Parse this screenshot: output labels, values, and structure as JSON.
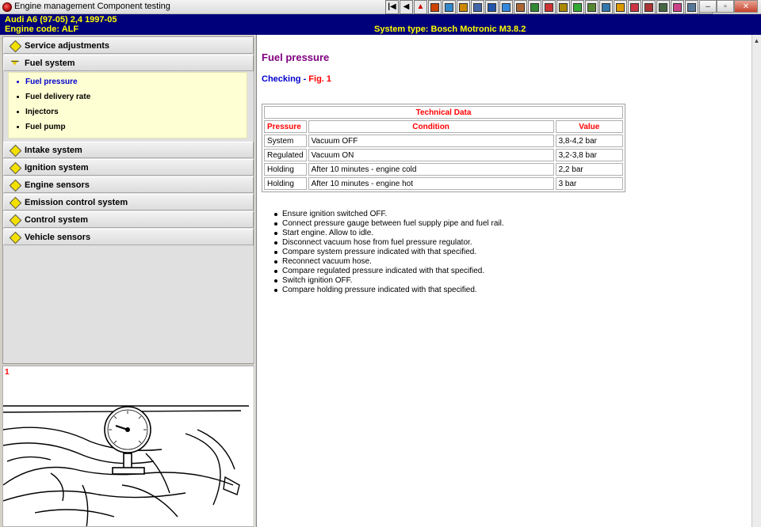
{
  "window": {
    "title": "Engine management Component testing",
    "minimize_label": "–",
    "maximize_label": "▫",
    "close_label": "✕"
  },
  "toolbar": {
    "buttons": [
      {
        "name": "first-icon",
        "glyph": "|◀",
        "color": "#000000"
      },
      {
        "name": "back-icon",
        "glyph": "◀",
        "color": "#000000"
      },
      {
        "name": "warning-icon",
        "glyph": "▲",
        "color": "#cc0000"
      },
      {
        "name": "tool-1-icon",
        "glyph": "",
        "color": "#cc4400"
      },
      {
        "name": "tool-2-icon",
        "glyph": "",
        "color": "#3388cc"
      },
      {
        "name": "tool-3-icon",
        "glyph": "",
        "color": "#cc8800"
      },
      {
        "name": "tool-4-icon",
        "glyph": "",
        "color": "#4466aa"
      },
      {
        "name": "tool-5-icon",
        "glyph": "",
        "color": "#2255aa"
      },
      {
        "name": "tool-6-icon",
        "glyph": "",
        "color": "#3388dd"
      },
      {
        "name": "tool-7-icon",
        "glyph": "",
        "color": "#aa6633"
      },
      {
        "name": "tool-8-icon",
        "glyph": "",
        "color": "#338833"
      },
      {
        "name": "tool-9-icon",
        "glyph": "",
        "color": "#cc3333"
      },
      {
        "name": "tool-10-icon",
        "glyph": "",
        "color": "#aa8800"
      },
      {
        "name": "tool-11-icon",
        "glyph": "",
        "color": "#33aa33"
      },
      {
        "name": "tool-12-icon",
        "glyph": "",
        "color": "#558833"
      },
      {
        "name": "tool-13-icon",
        "glyph": "",
        "color": "#3377aa"
      },
      {
        "name": "tool-14-icon",
        "glyph": "",
        "color": "#dd9900"
      },
      {
        "name": "tool-15-icon",
        "glyph": "",
        "color": "#cc3344"
      },
      {
        "name": "tool-16-icon",
        "glyph": "",
        "color": "#aa3333"
      },
      {
        "name": "tool-17-icon",
        "glyph": "",
        "color": "#446644"
      },
      {
        "name": "tool-18-icon",
        "glyph": "",
        "color": "#cc4488"
      },
      {
        "name": "tool-19-icon",
        "glyph": "",
        "color": "#557799"
      },
      {
        "name": "tool-20-icon",
        "glyph": "",
        "color": "#dddd44"
      }
    ]
  },
  "header": {
    "vehicle": "Audi   A6 (97-05) 2,4  1997-05",
    "engine_code": "Engine code: ALF",
    "system_type": "System type: Bosch Motronic M3.8.2",
    "background": "#00007a",
    "text_color": "#ffff00"
  },
  "nav": {
    "items": [
      {
        "label": "Service adjustments",
        "open": false
      },
      {
        "label": "Fuel system",
        "open": true
      },
      {
        "label": "Intake system",
        "open": false
      },
      {
        "label": "Ignition system",
        "open": false
      },
      {
        "label": "Engine sensors",
        "open": false
      },
      {
        "label": "Emission control system",
        "open": false
      },
      {
        "label": "Control system",
        "open": false
      },
      {
        "label": "Vehicle sensors",
        "open": false
      }
    ],
    "fuel_subitems": [
      {
        "label": "Fuel pressure",
        "active": true
      },
      {
        "label": "Fuel delivery rate",
        "active": false
      },
      {
        "label": "Injectors",
        "active": false
      },
      {
        "label": "Fuel pump",
        "active": false
      }
    ]
  },
  "figure": {
    "number": "1"
  },
  "content": {
    "title": "Fuel pressure",
    "checking": "Checking - ",
    "fig_ref": "Fig. 1",
    "table": {
      "caption": "Technical Data",
      "headers": [
        "Pressure",
        "Condition",
        "Value"
      ],
      "rows": [
        [
          "System",
          "Vacuum OFF",
          "3,8-4,2 bar"
        ],
        [
          "Regulated",
          "Vacuum ON",
          "3,2-3,8 bar"
        ],
        [
          "Holding",
          "After 10 minutes - engine cold",
          "2,2 bar"
        ],
        [
          "Holding",
          "After 10 minutes - engine hot",
          "3 bar"
        ]
      ]
    },
    "steps": [
      "Ensure ignition switched OFF.",
      "Connect pressure gauge between fuel supply pipe and fuel rail.",
      "Start engine. Allow to idle.",
      "Disconnect vacuum hose from fuel pressure regulator.",
      "Compare system pressure indicated with that specified.",
      "Reconnect vacuum hose.",
      "Compare regulated pressure indicated with that specified.",
      "Switch ignition OFF.",
      "Compare holding pressure indicated with that specified."
    ]
  },
  "colors": {
    "title": "#800080",
    "link": "#0000cc",
    "table_header": "#ff0000"
  }
}
